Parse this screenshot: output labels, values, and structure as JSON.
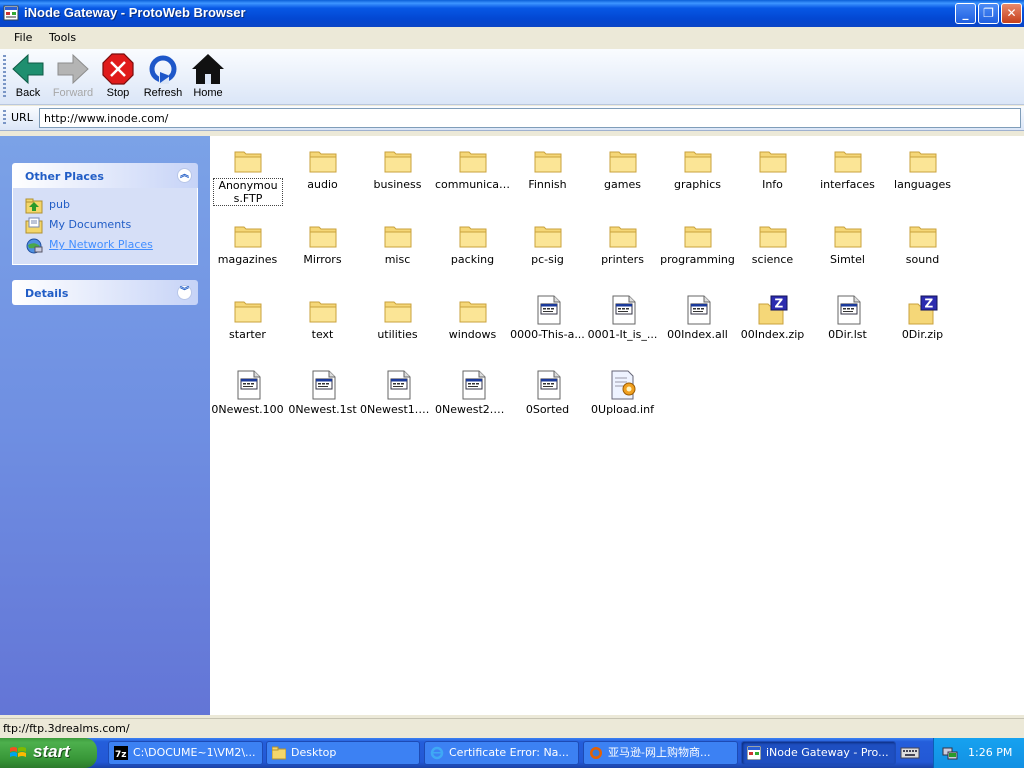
{
  "window": {
    "title": "iNode Gateway - ProtoWeb Browser",
    "controls": [
      "minimize-icon",
      "restore-icon",
      "close-icon"
    ]
  },
  "menu": {
    "items": [
      "File",
      "Tools"
    ]
  },
  "toolbar": {
    "back_label": "Back",
    "forward_label": "Forward",
    "stop_label": "Stop",
    "refresh_label": "Refresh",
    "home_label": "Home"
  },
  "address": {
    "label": "URL",
    "value": "http://www.inode.com/"
  },
  "taskpane": {
    "other_places": {
      "title": "Other Places",
      "items": [
        {
          "label": "pub",
          "icon": "folder-up-icon"
        },
        {
          "label": "My Documents",
          "icon": "my-documents-icon"
        },
        {
          "label": "My Network Places",
          "icon": "network-places-icon"
        }
      ]
    },
    "details": {
      "title": "Details"
    }
  },
  "files": [
    {
      "name": "Anonymous.FTP",
      "type": "folder",
      "selected": true
    },
    {
      "name": "audio",
      "type": "folder"
    },
    {
      "name": "business",
      "type": "folder"
    },
    {
      "name": "communicati...",
      "type": "folder"
    },
    {
      "name": "Finnish",
      "type": "folder"
    },
    {
      "name": "games",
      "type": "folder"
    },
    {
      "name": "graphics",
      "type": "folder"
    },
    {
      "name": "Info",
      "type": "folder"
    },
    {
      "name": "interfaces",
      "type": "folder"
    },
    {
      "name": "languages",
      "type": "folder"
    },
    {
      "name": "magazines",
      "type": "folder"
    },
    {
      "name": "Mirrors",
      "type": "folder"
    },
    {
      "name": "misc",
      "type": "folder"
    },
    {
      "name": "packing",
      "type": "folder"
    },
    {
      "name": "pc-sig",
      "type": "folder"
    },
    {
      "name": "printers",
      "type": "folder"
    },
    {
      "name": "programming",
      "type": "folder"
    },
    {
      "name": "science",
      "type": "folder"
    },
    {
      "name": "Simtel",
      "type": "folder"
    },
    {
      "name": "sound",
      "type": "folder"
    },
    {
      "name": "starter",
      "type": "folder"
    },
    {
      "name": "text",
      "type": "folder"
    },
    {
      "name": "utilities",
      "type": "folder"
    },
    {
      "name": "windows",
      "type": "folder"
    },
    {
      "name": "0000-This-a...",
      "type": "file"
    },
    {
      "name": "0001-It_is_...",
      "type": "file"
    },
    {
      "name": "00Index.all",
      "type": "file"
    },
    {
      "name": "00Index.zip",
      "type": "zip"
    },
    {
      "name": "0Dir.lst",
      "type": "file"
    },
    {
      "name": "0Dir.zip",
      "type": "zip"
    },
    {
      "name": "0Newest.100",
      "type": "file"
    },
    {
      "name": "0Newest.1st",
      "type": "file"
    },
    {
      "name": "0Newest1.1st",
      "type": "file"
    },
    {
      "name": "0Newest2.1st",
      "type": "file"
    },
    {
      "name": "0Sorted",
      "type": "file"
    },
    {
      "name": "0Upload.inf",
      "type": "inf"
    }
  ],
  "status": {
    "text": "ftp://ftp.3drealms.com/"
  },
  "taskbar": {
    "start_label": "start",
    "tasks": [
      {
        "label": "C:\\DOCUME~1\\VM2\\...",
        "icon": "7zip-icon"
      },
      {
        "label": "Desktop",
        "icon": "folder-icon"
      },
      {
        "label": "Certificate Error: Na...",
        "icon": "ie-icon"
      },
      {
        "label": "亚马逊-网上购物商...",
        "icon": "firefox-icon"
      },
      {
        "label": "iNode Gateway - Pro...",
        "icon": "app-icon",
        "active": true
      }
    ],
    "clock": "1:26 PM"
  }
}
